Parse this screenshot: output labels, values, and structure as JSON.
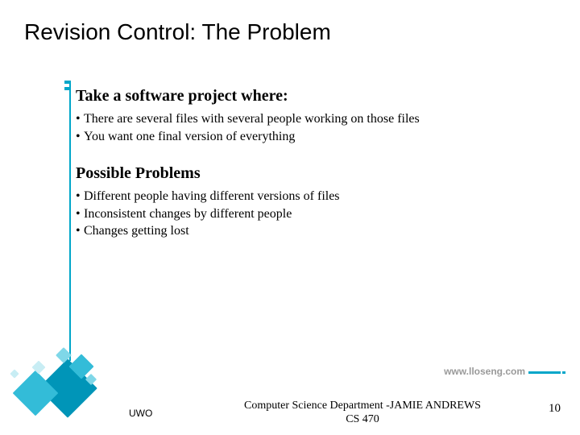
{
  "title": "Revision Control: The Problem",
  "section1": {
    "heading": "Take a software project where:",
    "bullets": [
      "There are several files with several people working on those files",
      "You want one final version of everything"
    ]
  },
  "section2": {
    "heading": "Possible Problems",
    "bullets": [
      "Different people having different versions of files",
      "Inconsistent changes by different people",
      "Changes getting lost"
    ]
  },
  "footer": {
    "url": "www.lloseng.com",
    "uwo": "UWO",
    "dept_line1": "Computer Science Department -JAMIE ANDREWS",
    "dept_line2": "CS 470",
    "page": "10"
  }
}
